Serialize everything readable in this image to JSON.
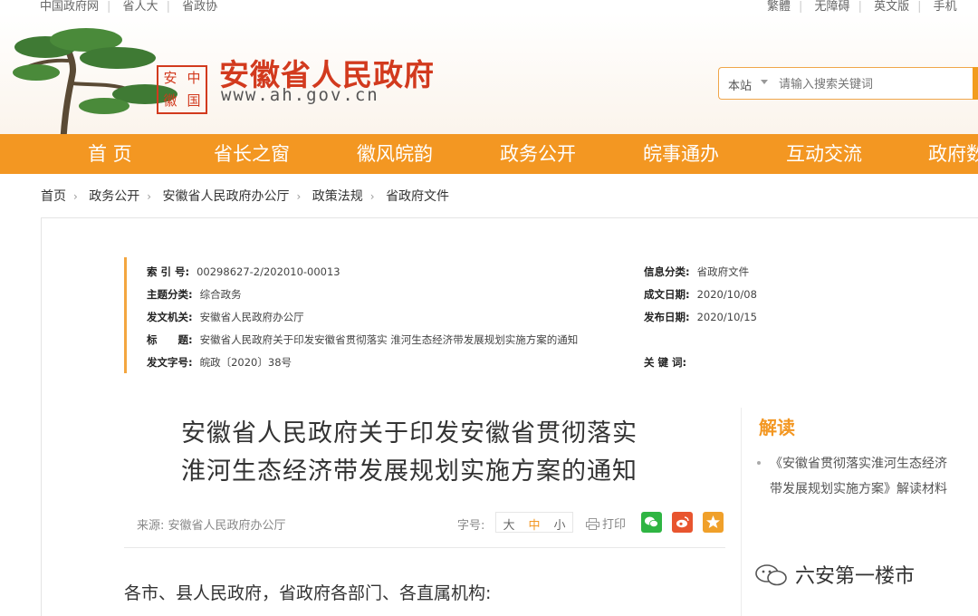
{
  "top_links": {
    "left": [
      "中国政府网",
      "省人大",
      "省政协"
    ],
    "right": [
      "繁體",
      "无障碍",
      "英文版",
      "手机"
    ]
  },
  "header": {
    "seal_chars": [
      "安",
      "中",
      "徽",
      "国"
    ],
    "site_title": "安徽省人民政府",
    "site_url": "www.ah.gov.cn",
    "search": {
      "scope": "本站",
      "placeholder": "请输入搜索关键词"
    }
  },
  "nav": {
    "items": [
      "首 页",
      "省长之窗",
      "徽风皖韵",
      "政务公开",
      "皖事通办",
      "互动交流",
      "政府数"
    ]
  },
  "breadcrumb": [
    "首页",
    "政务公开",
    "安徽省人民政府办公厅",
    "政策法规",
    "省政府文件"
  ],
  "meta": {
    "index_no": {
      "k": "索 引 号:",
      "v": "00298627-2/202010-00013"
    },
    "topic": {
      "k": "主题分类:",
      "v": "综合政务"
    },
    "issuer": {
      "k": "发文机关:",
      "v": "安徽省人民政府办公厅"
    },
    "title": {
      "k": "标　　题:",
      "v": "安徽省人民政府关于印发安徽省贯彻落实 淮河生态经济带发展规划实施方案的通知"
    },
    "doc_no": {
      "k": "发文字号:",
      "v": "皖政〔2020〕38号"
    },
    "info_class": {
      "k": "信息分类:",
      "v": "省政府文件"
    },
    "created": {
      "k": "成文日期:",
      "v": "2020/10/08"
    },
    "published": {
      "k": "发布日期:",
      "v": "2020/10/15"
    },
    "keywords": {
      "k": "关 键 词:",
      "v": ""
    }
  },
  "article": {
    "title_line1": "安徽省人民政府关于印发安徽省贯彻落实",
    "title_line2": "淮河生态经济带发展规划实施方案的通知",
    "source": "来源: 安徽省人民政府办公厅",
    "font_label": "字号:",
    "font_sizes": [
      "大",
      "中",
      "小"
    ],
    "print_label": "打印",
    "greeting": "各市、县人民政府，省政府各部门、各直属机构:"
  },
  "sidebar": {
    "title": "解读",
    "items": [
      "《安徽省贯彻落实淮河生态经济带发展规划实施方案》解读材料"
    ]
  },
  "watermark": "六安第一楼市",
  "colors": {
    "brand_orange": "#f39722",
    "seal_red": "#d23a1e",
    "wechat": "#2fb543",
    "weibo": "#e8552f",
    "favorite": "#f0a02a"
  }
}
